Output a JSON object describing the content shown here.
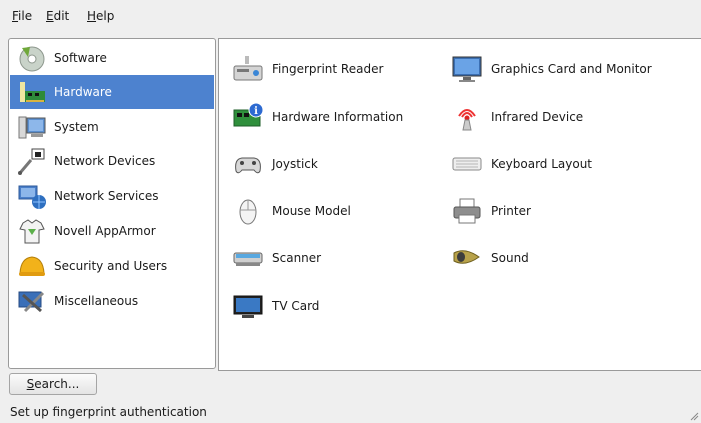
{
  "menubar": {
    "items": [
      {
        "mnemonic": "F",
        "rest": "ile"
      },
      {
        "mnemonic": "E",
        "rest": "dit"
      },
      {
        "mnemonic": "H",
        "rest": "elp"
      }
    ]
  },
  "sidebar": {
    "selected": "Hardware",
    "items": [
      {
        "label": "Software",
        "icon": "software-icon"
      },
      {
        "label": "Hardware",
        "icon": "hardware-icon"
      },
      {
        "label": "System",
        "icon": "system-icon"
      },
      {
        "label": "Network Devices",
        "icon": "network-devices-icon"
      },
      {
        "label": "Network Services",
        "icon": "network-services-icon"
      },
      {
        "label": "Novell AppArmor",
        "icon": "apparmor-icon"
      },
      {
        "label": "Security and Users",
        "icon": "security-users-icon"
      },
      {
        "label": "Miscellaneous",
        "icon": "miscellaneous-icon"
      }
    ]
  },
  "modules": {
    "items": [
      {
        "label": "Fingerprint Reader",
        "icon": "fingerprint-reader-icon"
      },
      {
        "label": "Graphics Card and Monitor",
        "icon": "monitor-icon"
      },
      {
        "label": "Hardware Information",
        "icon": "hardware-information-icon"
      },
      {
        "label": "Infrared Device",
        "icon": "infrared-icon"
      },
      {
        "label": "Joystick",
        "icon": "joystick-icon"
      },
      {
        "label": "Keyboard Layout",
        "icon": "keyboard-icon"
      },
      {
        "label": "Mouse Model",
        "icon": "mouse-icon"
      },
      {
        "label": "Printer",
        "icon": "printer-icon"
      },
      {
        "label": "Scanner",
        "icon": "scanner-icon"
      },
      {
        "label": "Sound",
        "icon": "sound-icon"
      },
      {
        "label": "TV Card",
        "icon": "tv-card-icon"
      }
    ]
  },
  "search_button": {
    "mnemonic": "S",
    "rest": "earch..."
  },
  "status_text": "Set up fingerprint authentication",
  "colors": {
    "selection": "#4d82cf",
    "panel_border": "#9a9a9a",
    "window_bg": "#efefef"
  }
}
